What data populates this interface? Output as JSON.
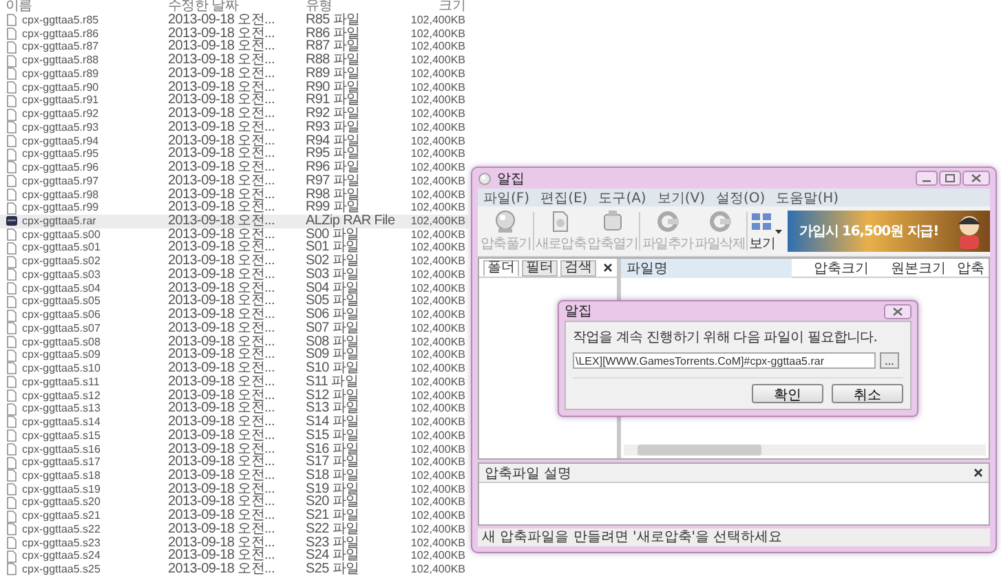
{
  "explorer": {
    "columns": [
      "이름",
      "수정한 날짜",
      "유형",
      "크기"
    ],
    "rows": [
      {
        "name": "cpx-ggttaa5.r85",
        "modified": "2013-09-18 오전...",
        "type": "R85 파일",
        "size": "102,400KB",
        "kind": "file",
        "selected": false
      },
      {
        "name": "cpx-ggttaa5.r86",
        "modified": "2013-09-18 오전...",
        "type": "R86 파일",
        "size": "102,400KB",
        "kind": "file",
        "selected": false
      },
      {
        "name": "cpx-ggttaa5.r87",
        "modified": "2013-09-18 오전...",
        "type": "R87 파일",
        "size": "102,400KB",
        "kind": "file",
        "selected": false
      },
      {
        "name": "cpx-ggttaa5.r88",
        "modified": "2013-09-18 오전...",
        "type": "R88 파일",
        "size": "102,400KB",
        "kind": "file",
        "selected": false
      },
      {
        "name": "cpx-ggttaa5.r89",
        "modified": "2013-09-18 오전...",
        "type": "R89 파일",
        "size": "102,400KB",
        "kind": "file",
        "selected": false
      },
      {
        "name": "cpx-ggttaa5.r90",
        "modified": "2013-09-18 오전...",
        "type": "R90 파일",
        "size": "102,400KB",
        "kind": "file",
        "selected": false
      },
      {
        "name": "cpx-ggttaa5.r91",
        "modified": "2013-09-18 오전...",
        "type": "R91 파일",
        "size": "102,400KB",
        "kind": "file",
        "selected": false
      },
      {
        "name": "cpx-ggttaa5.r92",
        "modified": "2013-09-18 오전...",
        "type": "R92 파일",
        "size": "102,400KB",
        "kind": "file",
        "selected": false
      },
      {
        "name": "cpx-ggttaa5.r93",
        "modified": "2013-09-18 오전...",
        "type": "R93 파일",
        "size": "102,400KB",
        "kind": "file",
        "selected": false
      },
      {
        "name": "cpx-ggttaa5.r94",
        "modified": "2013-09-18 오전...",
        "type": "R94 파일",
        "size": "102,400KB",
        "kind": "file",
        "selected": false
      },
      {
        "name": "cpx-ggttaa5.r95",
        "modified": "2013-09-18 오전...",
        "type": "R95 파일",
        "size": "102,400KB",
        "kind": "file",
        "selected": false
      },
      {
        "name": "cpx-ggttaa5.r96",
        "modified": "2013-09-18 오전...",
        "type": "R96 파일",
        "size": "102,400KB",
        "kind": "file",
        "selected": false
      },
      {
        "name": "cpx-ggttaa5.r97",
        "modified": "2013-09-18 오전...",
        "type": "R97 파일",
        "size": "102,400KB",
        "kind": "file",
        "selected": false
      },
      {
        "name": "cpx-ggttaa5.r98",
        "modified": "2013-09-18 오전...",
        "type": "R98 파일",
        "size": "102,400KB",
        "kind": "file",
        "selected": false
      },
      {
        "name": "cpx-ggttaa5.r99",
        "modified": "2013-09-18 오전...",
        "type": "R99 파일",
        "size": "102,400KB",
        "kind": "file",
        "selected": false
      },
      {
        "name": "cpx-ggttaa5.rar",
        "modified": "2013-09-18 오전...",
        "type": "ALZip RAR File",
        "size": "102,400KB",
        "kind": "archive",
        "selected": true
      },
      {
        "name": "cpx-ggttaa5.s00",
        "modified": "2013-09-18 오전...",
        "type": "S00 파일",
        "size": "102,400KB",
        "kind": "file",
        "selected": false
      },
      {
        "name": "cpx-ggttaa5.s01",
        "modified": "2013-09-18 오전...",
        "type": "S01 파일",
        "size": "102,400KB",
        "kind": "file",
        "selected": false
      },
      {
        "name": "cpx-ggttaa5.s02",
        "modified": "2013-09-18 오전...",
        "type": "S02 파일",
        "size": "102,400KB",
        "kind": "file",
        "selected": false
      },
      {
        "name": "cpx-ggttaa5.s03",
        "modified": "2013-09-18 오전...",
        "type": "S03 파일",
        "size": "102,400KB",
        "kind": "file",
        "selected": false
      },
      {
        "name": "cpx-ggttaa5.s04",
        "modified": "2013-09-18 오전...",
        "type": "S04 파일",
        "size": "102,400KB",
        "kind": "file",
        "selected": false
      },
      {
        "name": "cpx-ggttaa5.s05",
        "modified": "2013-09-18 오전...",
        "type": "S05 파일",
        "size": "102,400KB",
        "kind": "file",
        "selected": false
      },
      {
        "name": "cpx-ggttaa5.s06",
        "modified": "2013-09-18 오전...",
        "type": "S06 파일",
        "size": "102,400KB",
        "kind": "file",
        "selected": false
      },
      {
        "name": "cpx-ggttaa5.s07",
        "modified": "2013-09-18 오전...",
        "type": "S07 파일",
        "size": "102,400KB",
        "kind": "file",
        "selected": false
      },
      {
        "name": "cpx-ggttaa5.s08",
        "modified": "2013-09-18 오전...",
        "type": "S08 파일",
        "size": "102,400KB",
        "kind": "file",
        "selected": false
      },
      {
        "name": "cpx-ggttaa5.s09",
        "modified": "2013-09-18 오전...",
        "type": "S09 파일",
        "size": "102,400KB",
        "kind": "file",
        "selected": false
      },
      {
        "name": "cpx-ggttaa5.s10",
        "modified": "2013-09-18 오전...",
        "type": "S10 파일",
        "size": "102,400KB",
        "kind": "file",
        "selected": false
      },
      {
        "name": "cpx-ggttaa5.s11",
        "modified": "2013-09-18 오전...",
        "type": "S11 파일",
        "size": "102,400KB",
        "kind": "file",
        "selected": false
      },
      {
        "name": "cpx-ggttaa5.s12",
        "modified": "2013-09-18 오전...",
        "type": "S12 파일",
        "size": "102,400KB",
        "kind": "file",
        "selected": false
      },
      {
        "name": "cpx-ggttaa5.s13",
        "modified": "2013-09-18 오전...",
        "type": "S13 파일",
        "size": "102,400KB",
        "kind": "file",
        "selected": false
      },
      {
        "name": "cpx-ggttaa5.s14",
        "modified": "2013-09-18 오전...",
        "type": "S14 파일",
        "size": "102,400KB",
        "kind": "file",
        "selected": false
      },
      {
        "name": "cpx-ggttaa5.s15",
        "modified": "2013-09-18 오전...",
        "type": "S15 파일",
        "size": "102,400KB",
        "kind": "file",
        "selected": false
      },
      {
        "name": "cpx-ggttaa5.s16",
        "modified": "2013-09-18 오전...",
        "type": "S16 파일",
        "size": "102,400KB",
        "kind": "file",
        "selected": false
      },
      {
        "name": "cpx-ggttaa5.s17",
        "modified": "2013-09-18 오전...",
        "type": "S17 파일",
        "size": "102,400KB",
        "kind": "file",
        "selected": false
      },
      {
        "name": "cpx-ggttaa5.s18",
        "modified": "2013-09-18 오전...",
        "type": "S18 파일",
        "size": "102,400KB",
        "kind": "file",
        "selected": false
      },
      {
        "name": "cpx-ggttaa5.s19",
        "modified": "2013-09-18 오전...",
        "type": "S19 파일",
        "size": "102,400KB",
        "kind": "file",
        "selected": false
      },
      {
        "name": "cpx-ggttaa5.s20",
        "modified": "2013-09-18 오전...",
        "type": "S20 파일",
        "size": "102,400KB",
        "kind": "file",
        "selected": false
      },
      {
        "name": "cpx-ggttaa5.s21",
        "modified": "2013-09-18 오전...",
        "type": "S21 파일",
        "size": "102,400KB",
        "kind": "file",
        "selected": false
      },
      {
        "name": "cpx-ggttaa5.s22",
        "modified": "2013-09-18 오전...",
        "type": "S22 파일",
        "size": "102,400KB",
        "kind": "file",
        "selected": false
      },
      {
        "name": "cpx-ggttaa5.s23",
        "modified": "2013-09-18 오전...",
        "type": "S23 파일",
        "size": "102,400KB",
        "kind": "file",
        "selected": false
      },
      {
        "name": "cpx-ggttaa5.s24",
        "modified": "2013-09-18 오전...",
        "type": "S24 파일",
        "size": "102,400KB",
        "kind": "file",
        "selected": false
      },
      {
        "name": "cpx-ggttaa5.s25",
        "modified": "2013-09-18 오전...",
        "type": "S25 파일",
        "size": "102,400KB",
        "kind": "file",
        "selected": false
      }
    ]
  },
  "app_window": {
    "title": "알집",
    "menu": [
      "파일(F)",
      "편집(E)",
      "도구(A)",
      "보기(V)",
      "설정(O)",
      "도움말(H)"
    ],
    "toolbar": [
      {
        "label": "압축풀기",
        "disabled": true
      },
      {
        "label": "새로압축",
        "disabled": true
      },
      {
        "label": "압축열기",
        "disabled": true
      },
      {
        "label": "파일추가",
        "disabled": true
      },
      {
        "label": "파일삭제",
        "disabled": true
      },
      {
        "label": "보기",
        "disabled": false
      }
    ],
    "banner": {
      "text": "가입시 16,500원 지급!"
    },
    "side_tabs": [
      {
        "label": "폴더",
        "selected": true
      },
      {
        "label": "필터",
        "selected": false
      },
      {
        "label": "검색",
        "selected": false
      }
    ],
    "list_columns": [
      "파일명",
      "압축크기",
      "원본크기",
      "압축"
    ],
    "description_panel": {
      "title": "압축파일 설명"
    },
    "status_bar": "새 압축파일을 만들려면 '새로압축'을 선택하세요"
  },
  "dialog": {
    "title": "알집",
    "message": "작업을 계속 진행하기 위해 다음 파일이 필요합니다.",
    "path_field": {
      "value": "\\LEX][WWW.GamesTorrents.CoM]#cpx-ggttaa5.rar"
    },
    "browse_button": "...",
    "buttons": [
      "확인",
      "취소"
    ]
  }
}
